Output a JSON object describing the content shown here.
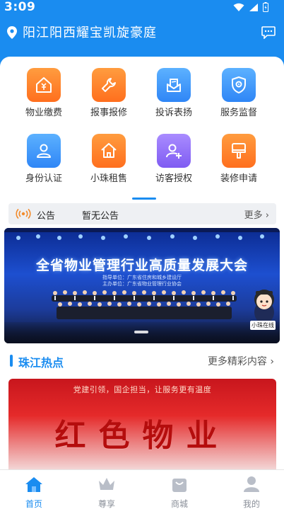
{
  "status_bar": {
    "time": "3:09"
  },
  "header": {
    "location": "阳江阳西耀宝凯旋豪庭"
  },
  "services": [
    {
      "label": "物业缴费",
      "icon": "house-yuan-icon",
      "color": "orange"
    },
    {
      "label": "报事报修",
      "icon": "wrench-icon",
      "color": "orange"
    },
    {
      "label": "投诉表扬",
      "icon": "envelope-icon",
      "color": "blue"
    },
    {
      "label": "服务监督",
      "icon": "shield-icon",
      "color": "blue"
    },
    {
      "label": "身份认证",
      "icon": "person-icon",
      "color": "blue"
    },
    {
      "label": "小珠租售",
      "icon": "home-icon",
      "color": "orange"
    },
    {
      "label": "访客授权",
      "icon": "add-person-icon",
      "color": "purple"
    },
    {
      "label": "装修申请",
      "icon": "paint-roller-icon",
      "color": "orange"
    }
  ],
  "notice": {
    "label": "公告",
    "text": "暂无公告",
    "more": "更多"
  },
  "banner": {
    "title": "全省物业管理行业高质量发展大会",
    "subtitle_1": "指导单位：广东省住房和城乡建设厅",
    "subtitle_2": "主办单位：广东省物业管理行业协会",
    "mascot_label": "小珠在线"
  },
  "section": {
    "title": "珠江热点",
    "more": "更多精彩内容"
  },
  "news_card": {
    "slogan": "党建引领，国企担当，让服务更有温度",
    "headline": "红色物业"
  },
  "tabs": [
    {
      "label": "首页",
      "icon": "home-tab-icon",
      "active": true
    },
    {
      "label": "尊享",
      "icon": "crown-icon",
      "active": false
    },
    {
      "label": "商城",
      "icon": "shopping-bag-icon",
      "active": false
    },
    {
      "label": "我的",
      "icon": "user-icon",
      "active": false
    }
  ],
  "colors": {
    "primary": "#1a8cf0",
    "orange": "#ff7f2a",
    "blue": "#3b93f8",
    "purple": "#8a6cf5"
  }
}
